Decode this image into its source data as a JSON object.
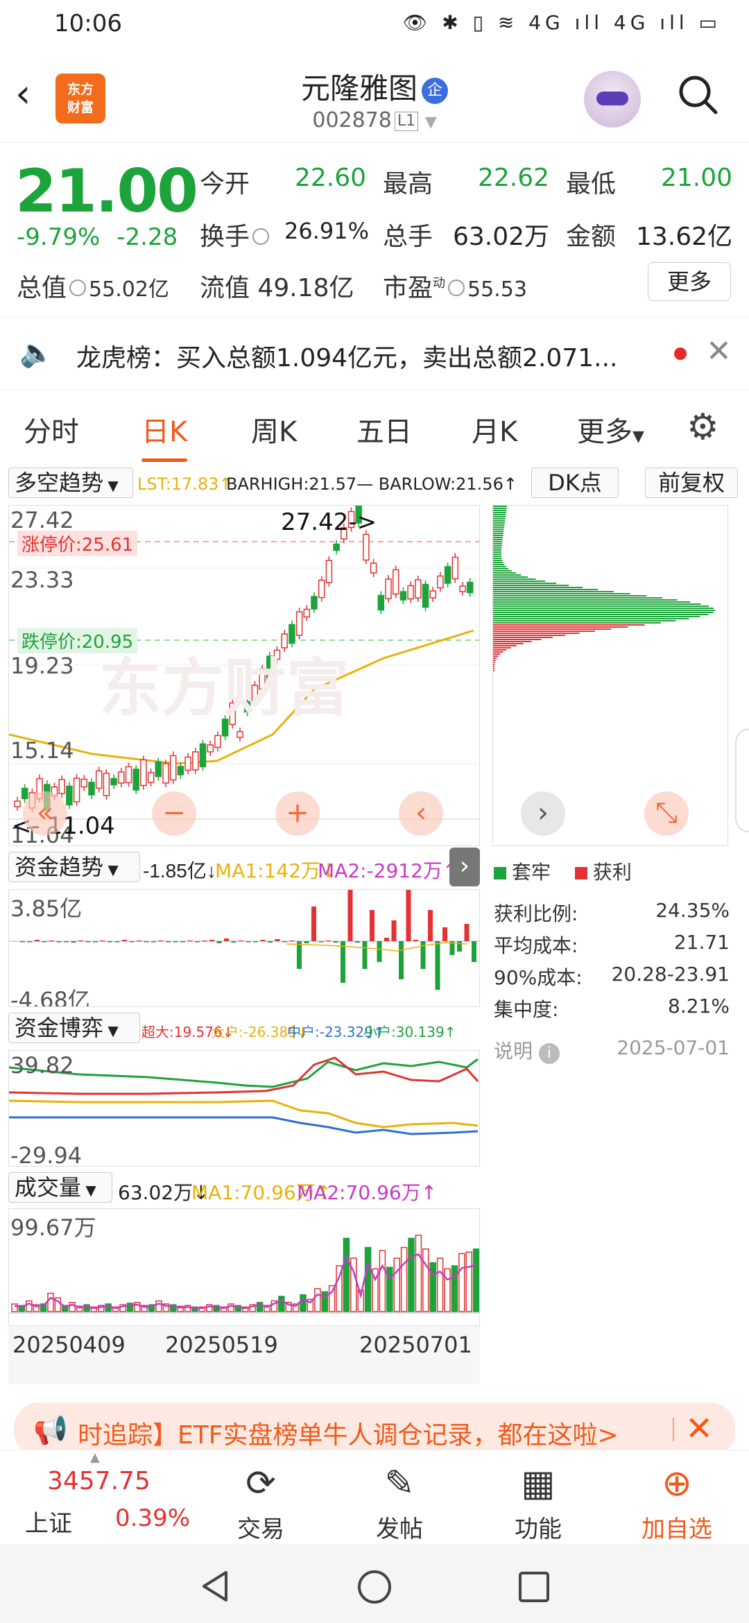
{
  "status_bar": {
    "time": "10:06",
    "icons": "👁 ✱ ▯ ≋ 4G ıll 4G ıll ▭"
  },
  "header": {
    "title": "元隆雅图",
    "title_badge": "企",
    "code": "002878",
    "code_tag": "L1",
    "logo_line1": "东方",
    "logo_line2": "财富"
  },
  "quote": {
    "price": "21.00",
    "change_pct": "-9.79%",
    "change": "-2.28",
    "open_label": "今开",
    "open": "22.60",
    "high_label": "最高",
    "high": "22.62",
    "low_label": "最低",
    "low": "21.00",
    "turnover_label": "换手",
    "turnover": "26.91%",
    "volume_label": "总手",
    "volume": "63.02万",
    "amount_label": "金额",
    "amount": "13.62亿",
    "mktcap_label": "总值",
    "mktcap": "55.02亿",
    "float_label": "流值",
    "float": "49.18亿",
    "pe_label": "市盈",
    "pe_sup": "动",
    "pe": "55.53",
    "more": "更多"
  },
  "notice": {
    "text": "龙虎榜：买入总额1.094亿元，卖出总额2.071..."
  },
  "tabs": [
    "分时",
    "日K",
    "周K",
    "五日",
    "月K",
    "更多"
  ],
  "chart": {
    "indicator": "多空趋势",
    "lst": "LST:17.83↑",
    "bar_hl": "BARHIGH:21.57— BARLOW:21.56↑",
    "dk_btn": "DK点",
    "fq_btn": "前复权",
    "y_top": "27.42",
    "y_2": "23.33",
    "y_3": "19.23",
    "y_4": "15.14",
    "y_bot": "11.04",
    "limit_up": "涨停价:25.61",
    "limit_down": "跌停价:20.95",
    "hi_mark": "27.42->",
    "lo_mark": "<- 11.04",
    "watermark": "东方财富",
    "btn_minus": "−",
    "btn_plus": "+",
    "btn_left": "‹",
    "btn_right": "›",
    "btn_expand": "⤡",
    "btn_rewind": "«"
  },
  "fund_trend": {
    "label": "资金趋势",
    "val": "-1.85亿↓",
    "ma1": "MA1:142万↓",
    "ma2": "MA2:-2912万↑",
    "y_top": "3.85亿",
    "y_bot": "-4.68亿"
  },
  "fund_game": {
    "label": "资金博弈",
    "super": "超大:19.576↓",
    "big": "大户:-26.385↓",
    "mid": "中户:-23.329↑",
    "small": "小户:30.139↑",
    "y_top": "39.82",
    "y_bot": "-29.94"
  },
  "volume": {
    "label": "成交量",
    "val": "63.02万↓",
    "ma1": "MA1:70.96万↑",
    "ma2": "MA2:70.96万↑",
    "y_top": "99.67万",
    "dates": [
      "20250409",
      "20250519",
      "20250701"
    ]
  },
  "chip": {
    "legend_a": "套牢",
    "legend_b": "获利",
    "rows": [
      [
        "获利比例:",
        "24.35%"
      ],
      [
        "平均成本:",
        "21.71"
      ],
      [
        "90%成本:",
        "20.28-23.91"
      ],
      [
        "集中度:",
        "8.21%"
      ]
    ],
    "note": "说明",
    "date": "2025-07-01"
  },
  "banner": {
    "text": "时追踪】ETF实盘榜单牛人调仓记录，都在这啦>"
  },
  "bottom": {
    "index_val": "3457.75",
    "index_name": "上证",
    "index_pct": "0.39%",
    "items": [
      "交易",
      "发帖",
      "功能",
      "加自选"
    ]
  },
  "colors": {
    "up": "#e23232",
    "down": "#1ca33a",
    "accent": "#f05a1a"
  }
}
